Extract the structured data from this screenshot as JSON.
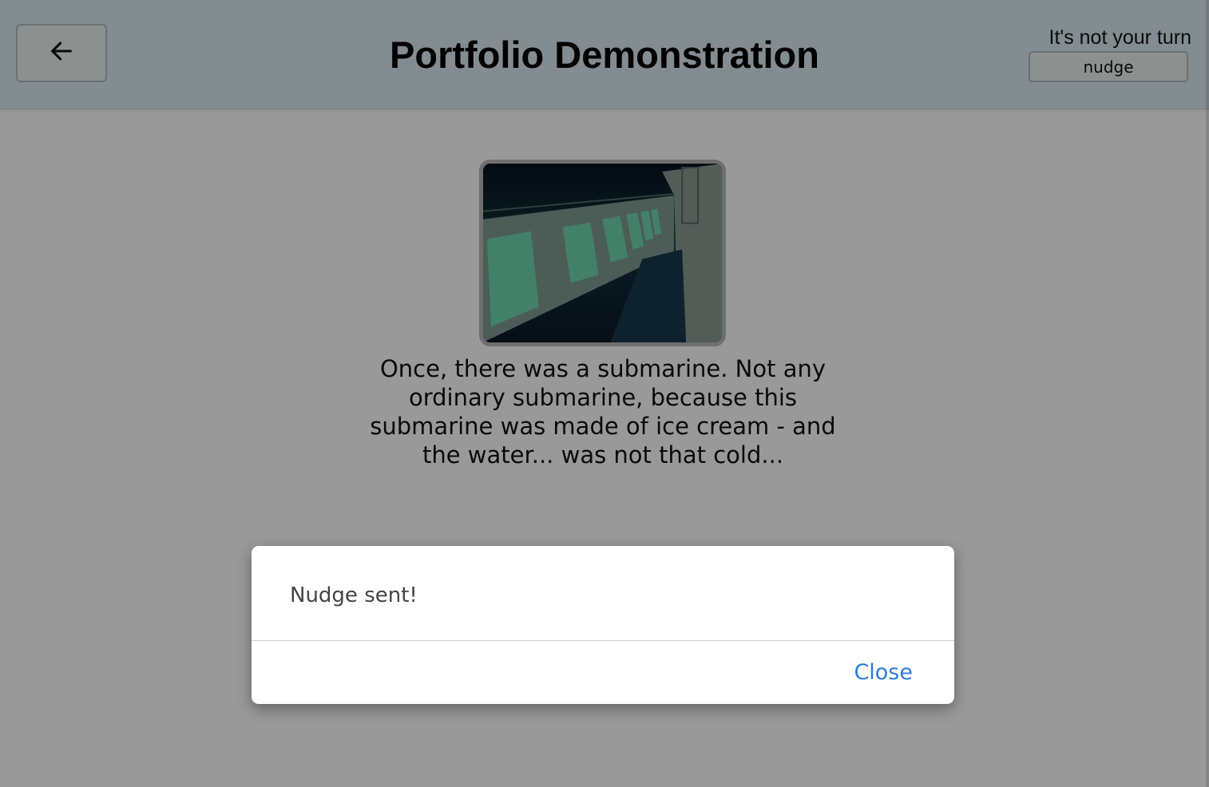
{
  "header": {
    "back_icon": "arrow-left-icon",
    "title": "Portfolio Demonstration",
    "turn_status": "It's not your turn",
    "nudge_label": "nudge"
  },
  "story": {
    "image_icon": "submarine-interior-image",
    "text": "Once, there was a submarine. Not any ordinary submarine, because this submarine was made of ice cream - and the water... was not that cold..."
  },
  "modal": {
    "message": "Nudge sent!",
    "close_label": "Close"
  },
  "colors": {
    "header_bg": "#dbe9f0",
    "button_bg": "#e9f2ee",
    "link_blue": "#2f7bd8",
    "overlay": "rgba(0,0,0,0.40)"
  }
}
